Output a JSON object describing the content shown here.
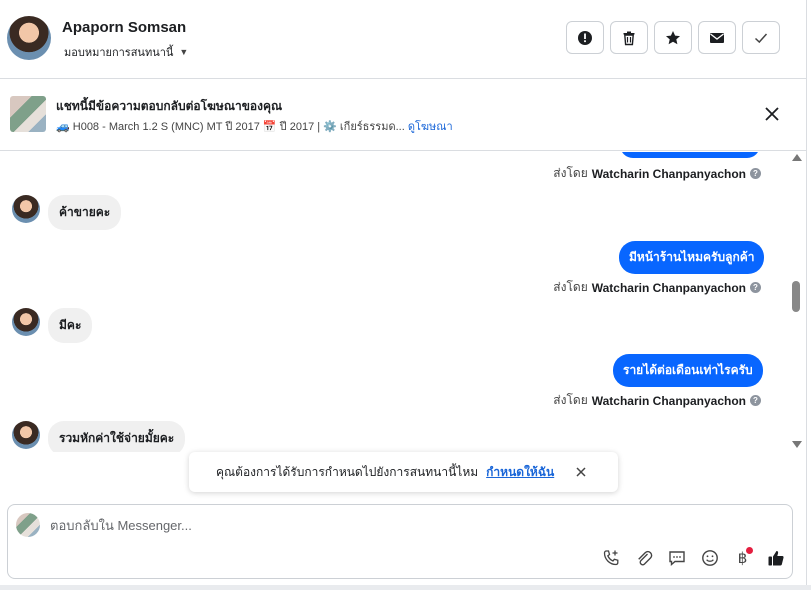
{
  "header": {
    "name": "Apaporn Somsan",
    "assign_label": "มอบหมายการสนทนานี้"
  },
  "ad_banner": {
    "title": "แชทนี้มีข้อความตอบกลับต่อโฆษณาของคุณ",
    "subtitle": "🚙 H008 - March 1.2 S (MNC) MT ปี 2017 📅 ปี 2017 | ⚙️ เกียร์ธรรมด...",
    "link": "ดูโฆษณา"
  },
  "messages": [
    {
      "sent_prefix": "ส่งโดย",
      "sender": "Watcharin Chanpanyachon"
    },
    {
      "incoming": "ค้าขายคะ"
    },
    {
      "outgoing": "มีหน้าร้านไหมครับลูกค้า"
    },
    {
      "sent_prefix": "ส่งโดย",
      "sender": "Watcharin Chanpanyachon"
    },
    {
      "incoming": "มีคะ"
    },
    {
      "outgoing": "รายได้ต่อเดือนเท่าไรครับ"
    },
    {
      "sent_prefix": "ส่งโดย",
      "sender": "Watcharin Chanpanyachon"
    },
    {
      "incoming": "รวมหักค่าใช้จ่ายมั้ยคะ"
    }
  ],
  "toast": {
    "text": "คุณต้องการได้รับการกำหนดไปยังการสนทนานี้ไหม",
    "link": "กำหนดให้ฉัน"
  },
  "composer": {
    "placeholder": "ตอบกลับใน Messenger...",
    "currency_symbol": "฿"
  },
  "colors": {
    "accent": "#0866ff",
    "link": "#1a66d8",
    "incoming_bubble": "#f0f0f0"
  }
}
